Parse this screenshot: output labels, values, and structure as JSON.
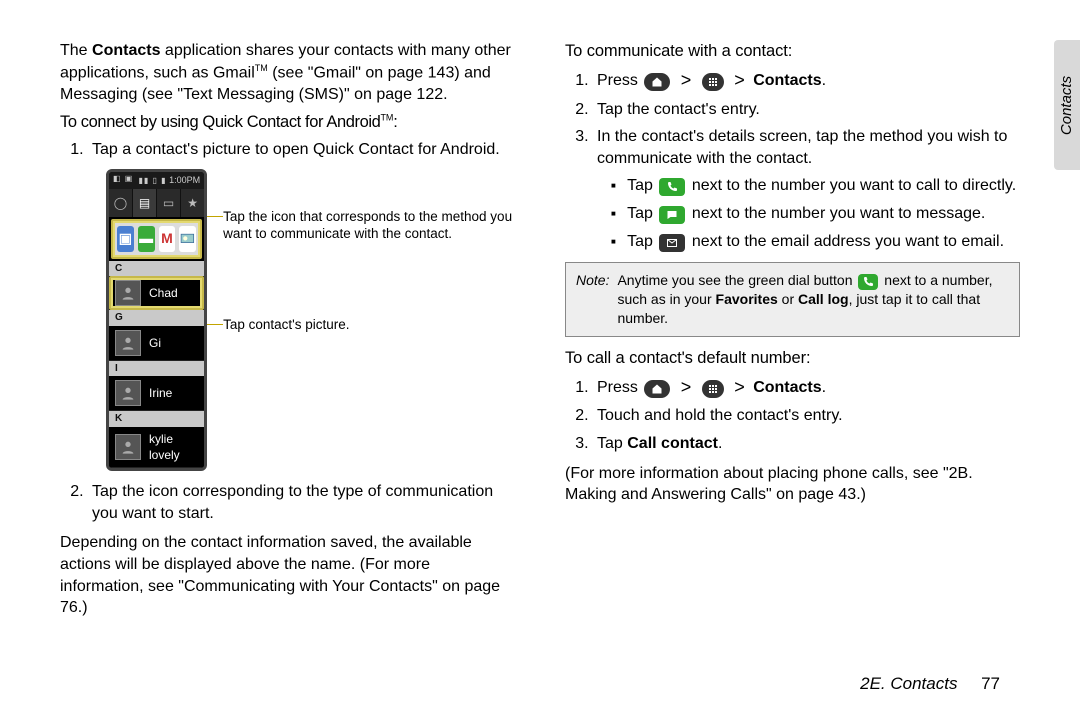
{
  "side_tab": "Contacts",
  "left": {
    "intro_prefix": "The ",
    "intro_bold": "Contacts",
    "intro_suffix": " application shares your contacts with many other applications, such as Gmail",
    "intro_tm": "TM",
    "intro_gmail_ref": " (see \"Gmail\" on page 143) and Messaging (see \"Text Messaging (SMS)\" on page 122.",
    "sec1_head": "To connect by using Quick Contact for Android",
    "sec1_tm": "TM",
    "sec1_head_colon": ":",
    "sec1_step1": "Tap a contact's picture to open Quick Contact for Android.",
    "sec1_step2": "Tap the icon corresponding to the type of communication you want to start.",
    "post_fig": "Depending on the contact information saved, the available actions will be displayed above the name. (For more information, see \"Communicating with Your Contacts\" on page 76.)",
    "anno1": "Tap the icon that corresponds to the method you want to communicate with the contact.",
    "anno2": "Tap contact's picture.",
    "phone": {
      "time": "1:00PM",
      "tabs": [
        "◯",
        "▤",
        "▭",
        "★"
      ],
      "dividers": [
        "C",
        "G",
        "I",
        "K"
      ],
      "contacts": [
        "Chad",
        "Gi",
        "Irine",
        "kylie lovely"
      ]
    }
  },
  "right": {
    "sec2_head": "To communicate with a contact:",
    "step1_pre": "Press ",
    "step1_contacts": "Contacts",
    "step1_post": ".",
    "step2": "Tap the contact's entry.",
    "step3": "In the contact's details screen, tap the method you wish to communicate with the contact.",
    "sub1_pre": "Tap ",
    "sub1_post": " next to the number you want to call to directly.",
    "sub2_pre": "Tap ",
    "sub2_post": " next to the number you want to message.",
    "sub3_pre": "Tap ",
    "sub3_post": " next to the email address you want to email.",
    "note_label": "Note:",
    "note_pre": "Anytime you see the green dial button ",
    "note_mid": " next to a number, such as in your ",
    "note_fav": "Favorites",
    "note_or": " or ",
    "note_calllog": "Call log",
    "note_post": ", just tap it to call that number.",
    "sec3_head": "To call a contact's default number:",
    "s3_step1_pre": "Press ",
    "s3_step1_contacts": "Contacts",
    "s3_step1_post": ".",
    "s3_step2": "Touch and hold the contact's entry.",
    "s3_step3_pre": "Tap ",
    "s3_step3_bold": "Call contact",
    "s3_step3_post": ".",
    "outro": "(For more information about placing phone calls, see \"2B. Making and Answering Calls\" on page 43.)"
  },
  "footer": {
    "section": "2E. Contacts",
    "page": "77"
  }
}
